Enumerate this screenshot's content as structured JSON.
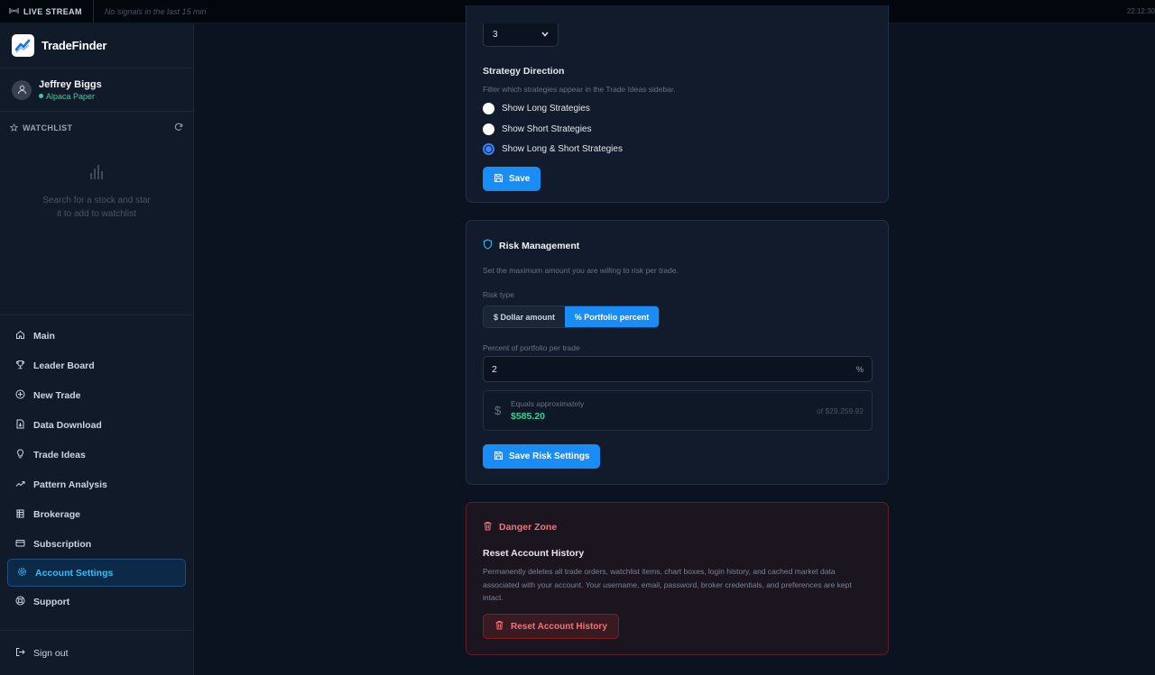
{
  "topbar": {
    "live_label": "LIVE STREAM",
    "status": "No signals in the last 15 min",
    "clock": "22:12:30"
  },
  "brand": {
    "name": "TradeFinder",
    "icon": "chart-trend-icon"
  },
  "user": {
    "name": "Jeffrey Biggs",
    "account": "Alpaca Paper",
    "icon": "user-icon"
  },
  "watchlist": {
    "title": "WATCHLIST",
    "empty_text": "Search for a stock and star it to add to watchlist"
  },
  "nav": {
    "items": [
      {
        "label": "Main",
        "icon": "home-icon"
      },
      {
        "label": "Leader Board",
        "icon": "trophy-icon"
      },
      {
        "label": "New Trade",
        "icon": "plus-circle-icon"
      },
      {
        "label": "Data Download",
        "icon": "file-download-icon"
      },
      {
        "label": "Trade Ideas",
        "icon": "lightbulb-icon"
      },
      {
        "label": "Pattern Analysis",
        "icon": "trending-up-icon"
      },
      {
        "label": "Brokerage",
        "icon": "bank-icon"
      },
      {
        "label": "Subscription",
        "icon": "credit-card-icon"
      },
      {
        "label": "Account Settings",
        "icon": "gear-icon"
      },
      {
        "label": "Support",
        "icon": "lifebuoy-icon"
      }
    ],
    "active": "Account Settings",
    "sign_out": "Sign out"
  },
  "strategy": {
    "select_value": "3",
    "title": "Strategy Direction",
    "hint": "Filter which strategies appear in the Trade Ideas sidebar.",
    "options": [
      "Show Long Strategies",
      "Show Short Strategies",
      "Show Long & Short Strategies"
    ],
    "selected": "Show Long & Short Strategies",
    "save_label": "Save"
  },
  "risk": {
    "title": "Risk Management",
    "description": "Set the maximum amount you are willing to risk per trade.",
    "risk_type_label": "Risk type",
    "types": [
      "$ Dollar amount",
      "% Portfolio percent"
    ],
    "active_type": "% Portfolio percent",
    "percent_label": "Percent of portfolio per trade",
    "percent_value": "2",
    "percent_unit": "%",
    "equals_label": "Equals approximately",
    "equals_value": "$585.20",
    "portfolio_total": "of $29,259.92",
    "save_label": "Save Risk Settings"
  },
  "danger": {
    "title": "Danger Zone",
    "subtitle": "Reset Account History",
    "description": "Permanently deletes all trade orders, watchlist items, chart boxes, login history, and cached market data associated with your account. Your username, email, password, broker credentials, and preferences are kept intact.",
    "button_label": "Reset Account History"
  },
  "colors": {
    "accent": "#1a8cf5",
    "success": "#34d399",
    "danger": "#f87171"
  }
}
